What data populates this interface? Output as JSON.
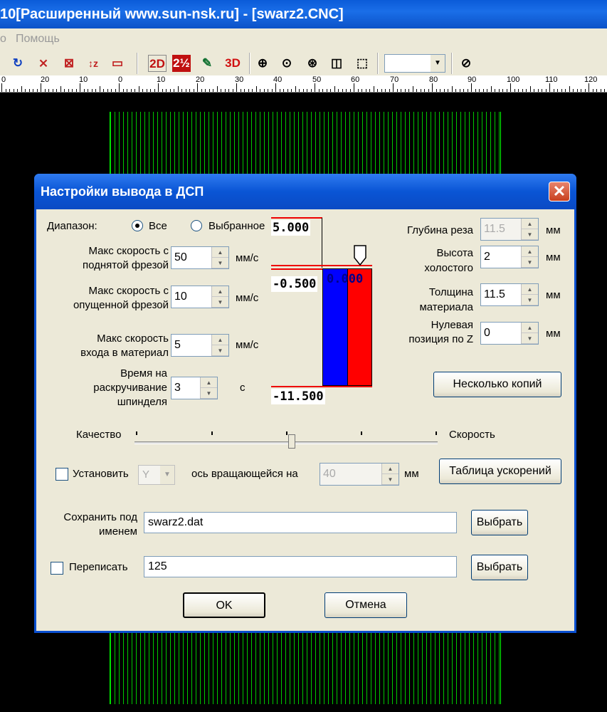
{
  "window": {
    "title": "10[Расширенный www.sun-nsk.ru] - [swarz2.CNC]"
  },
  "menu": {
    "items": [
      "о",
      "Помощь"
    ]
  },
  "toolbar": {
    "icons": [
      "refresh-icon",
      "cross-icon",
      "cross-box-icon",
      "z-axis-icon",
      "rect-icon",
      "2d-icon",
      "25d-icon",
      "brush-icon",
      "3d-icon",
      "zoom-in-icon",
      "zoom-area-icon",
      "zoom-fit-icon",
      "zoom-window-icon",
      "zoom-select-icon",
      "help-cursor-icon"
    ],
    "labels": {
      "d2": "2D",
      "d25": "2½",
      "d3": "3D"
    },
    "combo_value": ""
  },
  "ruler": {
    "labels": [
      "0",
      "20",
      "10",
      "0",
      "10",
      "20",
      "30",
      "40",
      "50",
      "60",
      "70",
      "80",
      "90",
      "100",
      "110",
      "120"
    ]
  },
  "dialog": {
    "title": "Настройки вывода в ДСП",
    "close_label": "✕",
    "range": {
      "label": "Диапазон:",
      "all": "Все",
      "selected": "Выбранное"
    },
    "max_speed_up": {
      "label1": "Макс скорость с",
      "label2": "поднятой фрезой",
      "value": "50",
      "unit": "мм/с"
    },
    "max_speed_down": {
      "label1": "Макс скорость с",
      "label2": "опущенной фрезой",
      "value": "10",
      "unit": "мм/с"
    },
    "max_speed_enter": {
      "label1": "Макс скорость",
      "label2": "входа в материал",
      "value": "5",
      "unit": "мм/с"
    },
    "spin_time": {
      "label1": "Время на",
      "label2": "раскручивание",
      "label3": "шпинделя",
      "value": "3",
      "unit": "с"
    },
    "cut_depth": {
      "label": "Глубина реза",
      "value": "11.5",
      "unit": "мм"
    },
    "idle_height": {
      "label1": "Высота",
      "label2": "холостого",
      "value": "2",
      "unit": "мм"
    },
    "material_thickness": {
      "label1": "Толщина",
      "label2": "материала",
      "value": "11.5",
      "unit": "мм"
    },
    "zero_pos": {
      "label1": "Нулевая",
      "label2": "позиция по Z",
      "value": "0",
      "unit": "мм"
    },
    "diagram": {
      "top": "5.000",
      "mid": "-0.500",
      "zero": "0.000",
      "bottom": "-11.500"
    },
    "copies_button": "Несколько копий",
    "quality_label": "Качество",
    "speed_label": "Скорость",
    "slider_position": 0.5,
    "rotary": {
      "label1": "Установить",
      "axis": "Y",
      "label2": "ось вращающейся на",
      "value": "40",
      "unit": "мм"
    },
    "accel_table_button": "Таблица ускорений",
    "save_as": {
      "label1": "Сохранить под",
      "label2": "именем",
      "value": "swarz2.dat",
      "button": "Выбрать"
    },
    "rewrite": {
      "label": "Переписать",
      "value": "125",
      "button": "Выбрать"
    },
    "ok_button": "OK",
    "cancel_button": "Отмена"
  }
}
